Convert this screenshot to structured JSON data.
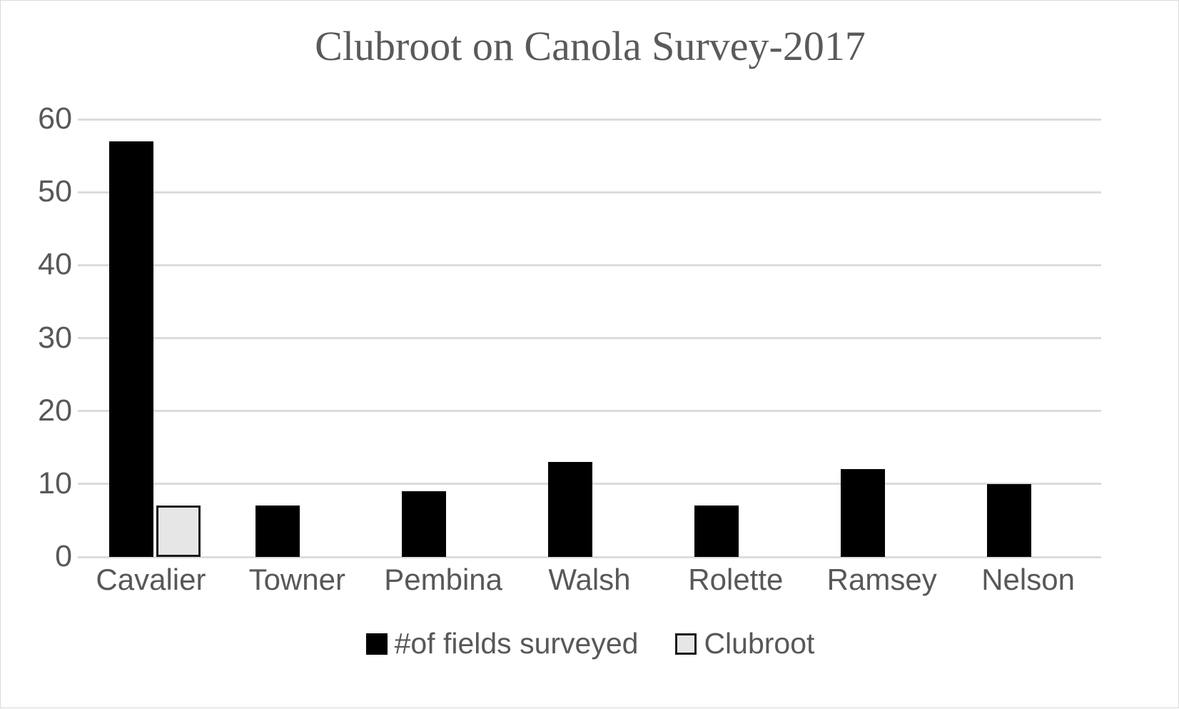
{
  "chart_data": {
    "type": "bar",
    "title": "Clubroot on Canola Survey-2017",
    "xlabel": "",
    "ylabel": "",
    "categories": [
      "Cavalier",
      "Towner",
      "Pembina",
      "Walsh",
      "Rolette",
      "Ramsey",
      "Nelson"
    ],
    "series": [
      {
        "name": "#of fields surveyed",
        "color": "#000000",
        "values": [
          57,
          7,
          9,
          13,
          7,
          12,
          10
        ]
      },
      {
        "name": "Clubroot",
        "color": "#e6e6e6",
        "border_color": "#1a1a1a",
        "values": [
          7,
          0,
          0,
          0,
          0,
          0,
          0
        ]
      }
    ],
    "ylim": [
      0,
      60
    ],
    "yticks": [
      "0",
      "10",
      "20",
      "30",
      "40",
      "50",
      "60"
    ],
    "ytick_values": [
      0,
      10,
      20,
      30,
      40,
      50,
      60
    ],
    "grid": true,
    "legend_position": "bottom",
    "title_color": "#5a5a5a",
    "axis_text_color": "#585858",
    "gridline_color": "#dcdcdc",
    "background_color": "#ffffff"
  },
  "legend": {
    "items": [
      {
        "label": "#of fields surveyed",
        "swatch": "black-square-icon"
      },
      {
        "label": "Clubroot",
        "swatch": "light-gray-square-icon"
      }
    ]
  }
}
